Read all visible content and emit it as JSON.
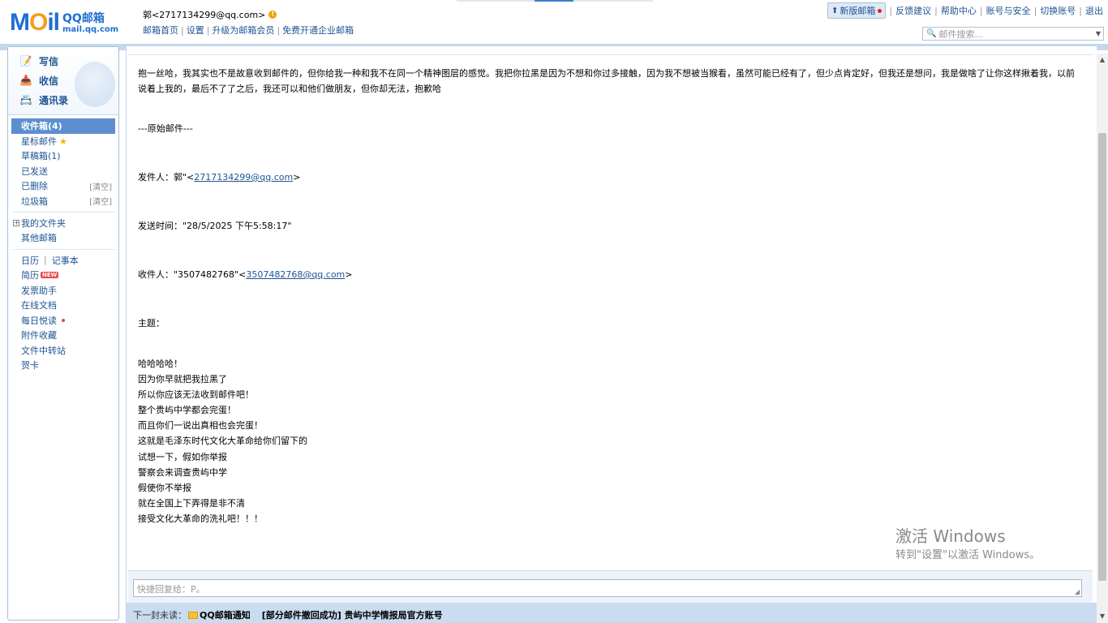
{
  "header": {
    "logo_main": "MOil",
    "logo_qq": "QQ邮箱",
    "logo_domain": "mail.qq.com",
    "user_display": "郭<2717134299@qq.com>",
    "user_links": [
      "邮箱首页",
      "设置",
      "升级为邮箱会员",
      "免费开通企业邮箱"
    ],
    "new_version": "新版邮箱",
    "right_links": [
      "反馈建议",
      "帮助中心",
      "账号与安全",
      "切换账号",
      "退出"
    ],
    "search_placeholder": "邮件搜索..."
  },
  "sidebar": {
    "quick": [
      {
        "label": "写信",
        "icon": "compose-icon"
      },
      {
        "label": "收信",
        "icon": "inbox-download-icon"
      },
      {
        "label": "通讯录",
        "icon": "contacts-icon"
      }
    ],
    "folders": [
      {
        "label": "收件箱(4)",
        "active": true
      },
      {
        "label": "星标邮件",
        "star": true
      },
      {
        "label": "草稿箱(1)"
      },
      {
        "label": "已发送"
      },
      {
        "label": "已删除",
        "clear": "[清空]"
      },
      {
        "label": "垃圾箱",
        "clear": "[清空]"
      }
    ],
    "my_folders": "我的文件夹",
    "other_mail": "其他邮箱",
    "calendar": "日历",
    "notebook": "记事本",
    "tools": [
      {
        "label": "简历",
        "tag": "NEW"
      },
      {
        "label": "发票助手"
      },
      {
        "label": "在线文档"
      },
      {
        "label": "每日悦读",
        "dot": true
      },
      {
        "label": "附件收藏"
      },
      {
        "label": "文件中转站"
      },
      {
        "label": "贺卡"
      }
    ]
  },
  "mail": {
    "intro": "抱一丝哈，我其实也不是故意收到邮件的，但你给我一种和我不在同一个精神图层的感觉。我把你拉黑是因为不想和你过多接触，因为我不想被当猴看，虽然可能已经有了，但少点肯定好，但我还是想问，我是做啥了让你这样揪着我，以前说着上我的，最后不了了之后，我还可以和他们做朋友，但你却无法，抱歉哈",
    "original_marker": "---原始邮件---",
    "from_label": "发件人：郭\"<",
    "from_email": "2717134299@qq.com",
    "from_suffix": ">",
    "time_line": "发送时间：\"28/5/2025 下午5:58:17\"",
    "to_label": "收件人：\"3507482768\"<",
    "to_email": "3507482768@qq.com",
    "to_suffix": ">",
    "subject_line": "主题：",
    "body_lines": [
      "哈哈哈哈！",
      "因为你早就把我拉黑了",
      "所以你应该无法收到邮件吧！",
      "整个贵屿中学都会完蛋！",
      "而且你们一说出真相也会完蛋！",
      "这就是毛泽东时代文化大革命给你们留下的",
      "试想一下，假如你举报",
      "警察会来调查贵屿中学",
      "假使你不举报",
      "就在全国上下弄得是非不清",
      "接受文化大革命的洗礼吧！！！"
    ],
    "reply_placeholder": "快捷回复给：P。",
    "next_label": "下一封未读：",
    "next_sender": "QQ邮箱通知",
    "next_subject": "[部分邮件撤回成功] 贵屿中学情报局官方账号"
  },
  "watermark": {
    "line1": "激活 Windows",
    "line2": "转到\"设置\"以激活 Windows。"
  },
  "colors": {
    "accent": "#1e5494",
    "active_folder": "#5c8fcf",
    "band": "#c4d8ee"
  }
}
